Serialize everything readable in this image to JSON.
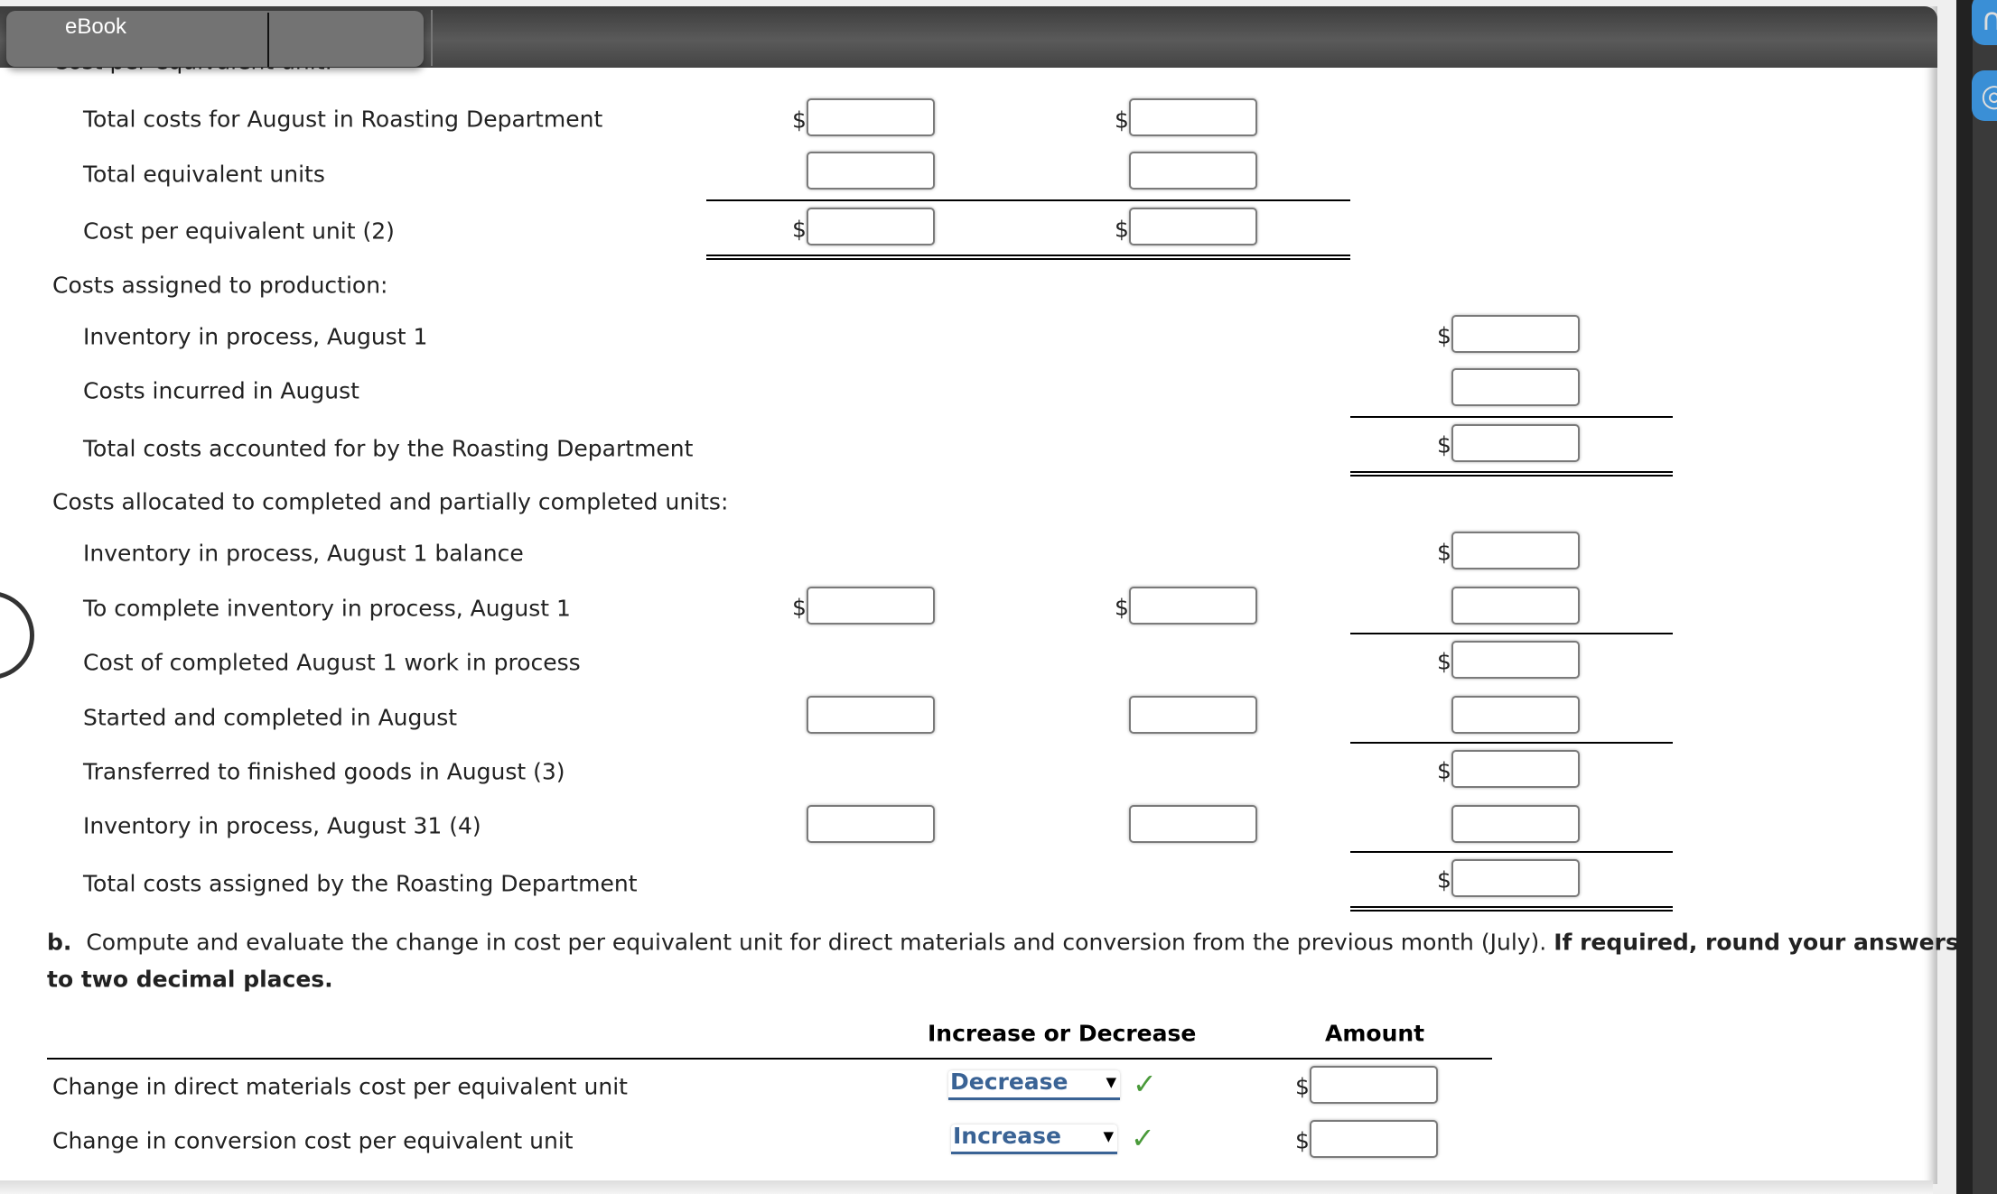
{
  "toolbar": {
    "ebook_label": "eBook"
  },
  "section_a": {
    "clipped_heading": "Cost per equivalent unit:",
    "cost_per_eu": {
      "rows": [
        {
          "label": "Total costs for August in Roasting Department"
        },
        {
          "label": "Total equivalent units"
        },
        {
          "label": "Cost per equivalent unit (2)"
        }
      ]
    },
    "costs_assigned_heading": "Costs assigned to production:",
    "costs_assigned_rows": [
      {
        "label": "Inventory in process, August 1"
      },
      {
        "label": "Costs incurred in August"
      },
      {
        "label": "Total costs accounted for by the Roasting Department"
      }
    ],
    "costs_allocated_heading": "Costs allocated to completed and partially completed units:",
    "costs_allocated_rows": [
      {
        "label": "Inventory in process, August 1 balance"
      },
      {
        "label": "To complete inventory in process, August 1"
      },
      {
        "label": "Cost of completed August 1 work in process"
      },
      {
        "label": "Started and completed in August"
      },
      {
        "label": "Transferred to finished goods in August (3)"
      },
      {
        "label": "Inventory in process, August 31 (4)"
      },
      {
        "label": "Total costs assigned by the Roasting Department"
      }
    ],
    "currency_symbol": "$"
  },
  "section_b": {
    "prefix": "b.",
    "instruction": "Compute and evaluate the change in cost per equivalent unit for direct materials and conversion from the previous month (July).",
    "instruction_bold": "If required, round your answers",
    "instruction_bold_line2": "to two decimal places.",
    "headers": {
      "direction": "Increase or Decrease",
      "amount": "Amount"
    },
    "rows": [
      {
        "label": "Change in direct materials cost per equivalent unit",
        "selected": "Decrease",
        "status": "correct"
      },
      {
        "label": "Change in conversion cost per equivalent unit",
        "selected": "Increase",
        "status": "correct"
      }
    ],
    "check_glyph": "✓",
    "dropdown_glyph": "▼"
  },
  "icons": {
    "headset": "headset-icon",
    "help": "help-icon"
  },
  "colors": {
    "select_text": "#3a6395",
    "check": "#4a9a3a",
    "rail_button": "#3a8fd6"
  }
}
